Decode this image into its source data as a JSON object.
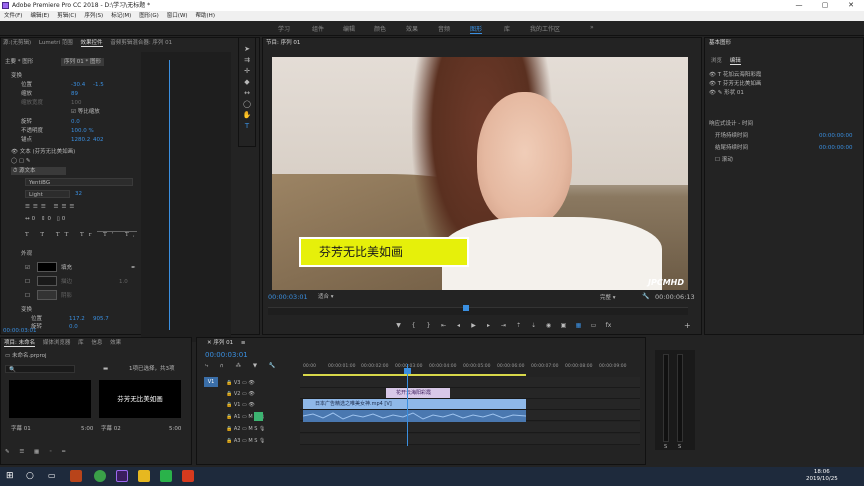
{
  "titlebar": {
    "title": "Adobe Premiere Pro CC 2018 - D:\\学习\\无标题 *"
  },
  "menubar": {
    "items": [
      "文件(F)",
      "编辑(E)",
      "剪辑(C)",
      "序列(S)",
      "标记(M)",
      "图形(G)",
      "窗口(W)",
      "帮助(H)"
    ]
  },
  "workspaces": {
    "items": [
      "学习",
      "组件",
      "编辑",
      "颜色",
      "效果",
      "音频",
      "图形",
      "库",
      "我的工作区"
    ],
    "active": "图形"
  },
  "effect_controls": {
    "tabs": [
      "源:(无剪辑)",
      "Lumetri 范围",
      "效果控件",
      "音频剪辑混合器: 序列 01"
    ],
    "active_tab": "效果控件",
    "header_left": "主要 * 图形",
    "header_right": "序列 01 * 图形",
    "rows": {
      "transform": "变换",
      "position": "位置",
      "position_x": "-30.4",
      "position_y": "-1.5",
      "scale": "缩放",
      "scale_val": "89",
      "scale_width": "缩放宽度",
      "scale_width_val": "100",
      "uniform_scale": "等比缩放",
      "rotation": "旋转",
      "rotation_val": "0.0",
      "opacity": "不透明度",
      "opacity_val": "100.0 %",
      "anchor": "锚点",
      "anchor_x": "1280.2",
      "anchor_y": "402",
      "text_layer": "文本 (芬芳无比美如画)",
      "source_text": "源文本",
      "font": "YentiBG",
      "font_style": "Light",
      "font_size": "32",
      "appearance": "外观",
      "fill": "填充",
      "stroke": "描边",
      "stroke_val": "1.0",
      "shadow": "阴影",
      "transform2": "变换",
      "position2": "位置",
      "position2_x": "117.2",
      "position2_y": "905.7",
      "rotation2": "旋转",
      "rotation2_val": "0.0",
      "timecode": "00:00:03:01"
    }
  },
  "program": {
    "title": "节目: 序列 01",
    "caption": "芬芳无比美如画",
    "watermark": "JPCMHD",
    "timecode_current": "00:00:03:01",
    "fit": "适合",
    "quality": "完整",
    "timecode_duration": "00:00:06:13"
  },
  "essential_graphics": {
    "title": "基本图形",
    "tabs": [
      "浏览",
      "编辑"
    ],
    "active_tab": "编辑",
    "layers": [
      "花加云海阳彩霞",
      "芬芳无比美如画",
      "形状 01"
    ],
    "responsive": "响应式设计 - 时间",
    "intro_duration": "开场持续时间",
    "intro_val": "00:00:00:00",
    "outro_duration": "结尾持续时间",
    "outro_val": "00:00:00:00",
    "roll": "滚动"
  },
  "project": {
    "tabs": [
      "项目: 未命名",
      "媒体浏览器",
      "库",
      "信息",
      "效果"
    ],
    "file": "未命名.prproj",
    "selection": "1项已选择，共3项",
    "item1_name": "字幕 01",
    "item1_dur": "5:00",
    "item2_name": "字幕 02",
    "item2_dur": "5:00",
    "item2_text": "芬芳无比美如画"
  },
  "timeline": {
    "title": "序列 01",
    "timecode": "00:00:03:01",
    "ruler": [
      "00:00",
      "00:00:01:00",
      "00:00:02:00",
      "00:00:03:00",
      "00:00:04:00",
      "00:00:05:00",
      "00:00:06:00",
      "00:00:07:00",
      "00:00:08:00",
      "00:00:09:00"
    ],
    "tracks": [
      "V3",
      "V2",
      "V1",
      "A1",
      "A2",
      "A3"
    ],
    "clip_title": "花开云海阳彩霞",
    "clip_video": "日本广告精选之唯美女神.mp4 [V]"
  },
  "meter": {
    "left": "S",
    "right": "S"
  },
  "taskbar": {
    "time": "18:06",
    "date": "2019/10/25"
  }
}
